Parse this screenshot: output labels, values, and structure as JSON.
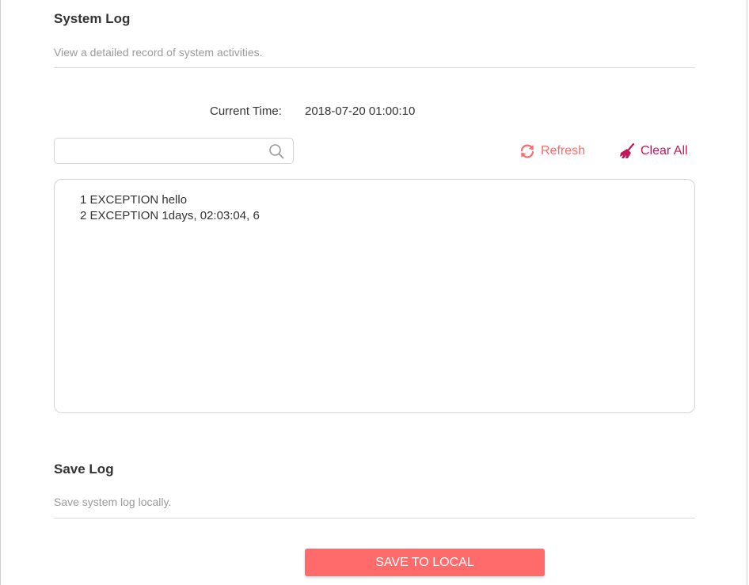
{
  "system_log": {
    "title": "System Log",
    "description": "View a detailed record of system activities.",
    "current_time_label": "Current Time:",
    "current_time_value": "2018-07-20 01:00:10",
    "search": {
      "value": "",
      "placeholder": ""
    },
    "refresh_label": "Refresh",
    "clear_all_label": "Clear All",
    "entries": [
      "1 EXCEPTION hello",
      "2 EXCEPTION 1days, 02:03:04, 6"
    ]
  },
  "save_log": {
    "title": "Save Log",
    "description": "Save system log locally.",
    "button_label": "SAVE TO LOCAL"
  },
  "icons": {
    "search": "search-icon",
    "refresh": "refresh-icon",
    "clear_all": "broom-icon"
  },
  "colors": {
    "accent": "#ff6b6b",
    "refresh": "#ff6a6a",
    "clear_all": "#c2185b"
  }
}
